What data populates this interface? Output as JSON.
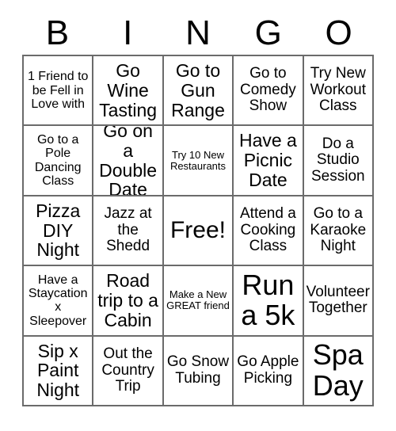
{
  "header": {
    "letters": [
      "B",
      "I",
      "N",
      "G",
      "O"
    ]
  },
  "colors": {
    "grid_border": "#6b6b6b",
    "text": "#000000",
    "background": "#ffffff"
  },
  "grid": {
    "columns": 5,
    "rows": 5,
    "cells": [
      {
        "text": "1 Friend to be Fell in Love with",
        "size": "fs-s",
        "free": false
      },
      {
        "text": "Go Wine Tasting",
        "size": "fs-l",
        "free": false
      },
      {
        "text": "Go to Gun Range",
        "size": "fs-l",
        "free": false
      },
      {
        "text": "Go to Comedy Show",
        "size": "fs-m",
        "free": false
      },
      {
        "text": "Try New Workout Class",
        "size": "fs-m",
        "free": false
      },
      {
        "text": "Go to a Pole Dancing Class",
        "size": "fs-s",
        "free": false
      },
      {
        "text": "Go on a Double Date",
        "size": "fs-l",
        "free": false
      },
      {
        "text": "Try 10 New Restaurants",
        "size": "fs-xs",
        "free": false
      },
      {
        "text": "Have a Picnic Date",
        "size": "fs-l",
        "free": false
      },
      {
        "text": "Do a Studio Session",
        "size": "fs-m",
        "free": false
      },
      {
        "text": "Pizza DIY Night",
        "size": "fs-l",
        "free": false
      },
      {
        "text": "Jazz at the Shedd",
        "size": "fs-m",
        "free": false
      },
      {
        "text": "Free!",
        "size": "fs-xl",
        "free": true
      },
      {
        "text": "Attend a Cooking Class",
        "size": "fs-m",
        "free": false
      },
      {
        "text": "Go to a Karaoke Night",
        "size": "fs-m",
        "free": false
      },
      {
        "text": "Have a Staycation x Sleepover",
        "size": "fs-s",
        "free": false
      },
      {
        "text": "Road trip to a Cabin",
        "size": "fs-l",
        "free": false
      },
      {
        "text": "Make a New GREAT friend",
        "size": "fs-xs",
        "free": false
      },
      {
        "text": "Run a 5k",
        "size": "fs-xxl",
        "free": false
      },
      {
        "text": "Volunteer Together",
        "size": "fs-m",
        "free": false
      },
      {
        "text": "Sip x Paint Night",
        "size": "fs-l",
        "free": false
      },
      {
        "text": "Out the Country Trip",
        "size": "fs-m",
        "free": false
      },
      {
        "text": "Go Snow Tubing",
        "size": "fs-m",
        "free": false
      },
      {
        "text": "Go Apple Picking",
        "size": "fs-m",
        "free": false
      },
      {
        "text": "Spa Day",
        "size": "fs-xxl",
        "free": false
      }
    ]
  }
}
